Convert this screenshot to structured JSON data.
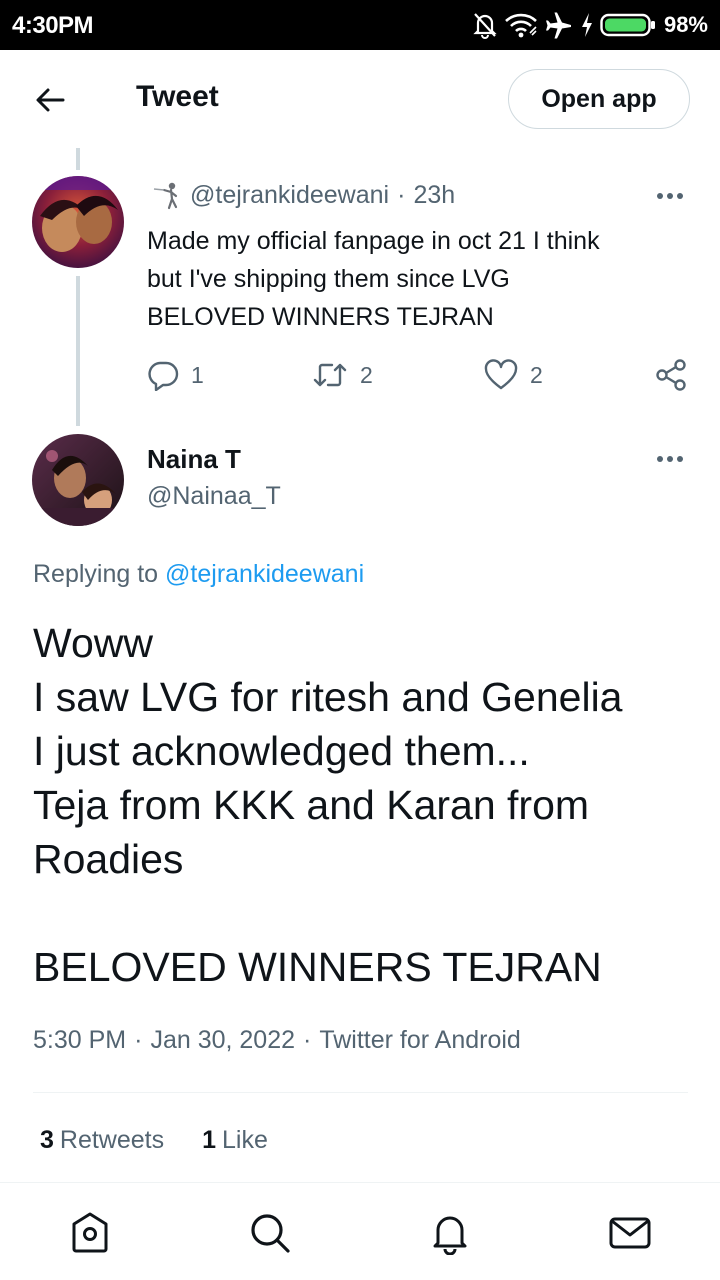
{
  "status_bar": {
    "time": "4:30PM",
    "battery": "98%",
    "icons": [
      "muted-bell-icon",
      "wifi-icon",
      "airplane-icon",
      "charging-icon",
      "battery-icon"
    ]
  },
  "header": {
    "title": "Tweet",
    "open_app_label": "Open app",
    "back_icon": "back-arrow-icon"
  },
  "parent_tweet": {
    "handle": "@tejrankideewani",
    "separator": "·",
    "time_ago": "23h",
    "text_lines": [
      "Made my official fanpage in oct 21 I think",
      "but I've shipping them since LVG",
      "BELOVED WINNERS TEJRAN"
    ],
    "reply_count": "1",
    "retweet_count": "2",
    "like_count": "2"
  },
  "tweet": {
    "author_name": "Naina T",
    "author_handle": "@Nainaa_T",
    "replying_prefix": "Replying to",
    "replying_to": "@tejrankideewani",
    "text_lines": [
      "Woww",
      "I saw LVG for ritesh and Genelia",
      "I just acknowledged them...",
      "Teja from KKK and Karan from",
      "Roadies",
      "",
      "BELOVED WINNERS TEJRAN"
    ],
    "time": "5:30 PM",
    "date": "Jan 30, 2022",
    "client": "Twitter for Android",
    "separator": "·",
    "retweets_count": "3",
    "retweets_label": "Retweets",
    "likes_count": "1",
    "likes_label": "Like"
  },
  "bottom_nav": {
    "items": [
      "home-icon",
      "search-icon",
      "notifications-icon",
      "messages-icon"
    ]
  },
  "colors": {
    "text": "#0f1419",
    "secondary": "#536471",
    "link": "#1d9bf0",
    "border": "#cfd9de",
    "battery_fill": "#4cd964"
  }
}
